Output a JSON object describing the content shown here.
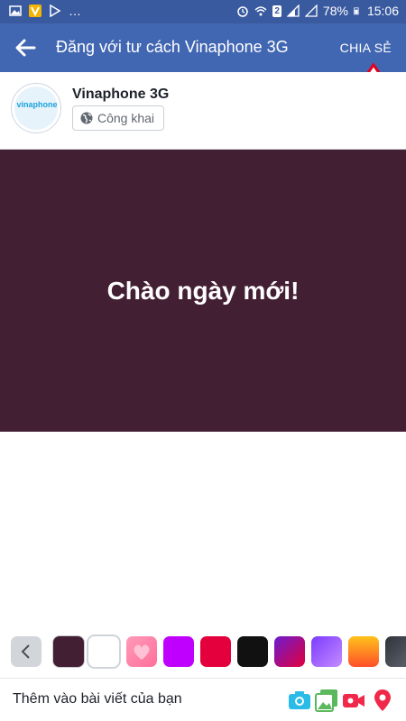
{
  "status": {
    "time": "15:06",
    "battery": "78%",
    "sim_badge": "2"
  },
  "app_bar": {
    "title": "Đăng với tư cách Vinaphone 3G",
    "share_label": "CHIA SẺ"
  },
  "author": {
    "name": "Vinaphone 3G",
    "privacy": "Công khai",
    "avatar_brand": "vinaphone"
  },
  "post": {
    "text": "Chào ngày mới!",
    "background_color": "#431f33"
  },
  "background_picker": {
    "swatches": [
      {
        "name": "dark-maroon",
        "color": "#431f33"
      },
      {
        "name": "white",
        "color": "#ffffff"
      },
      {
        "name": "pink-hearts",
        "color": "#ff8fb0"
      },
      {
        "name": "purple",
        "color": "#c000ff"
      },
      {
        "name": "crimson",
        "color": "#e3003c"
      },
      {
        "name": "black",
        "color": "#111111"
      },
      {
        "name": "purple-red-gradient",
        "color": "#8a2be2"
      },
      {
        "name": "violet-gradient",
        "color": "#9a4dff"
      },
      {
        "name": "orange-gradient",
        "color": "#ff8a2b"
      },
      {
        "name": "dark-gradient",
        "color": "#3b3f47"
      }
    ]
  },
  "bottom_bar": {
    "add_label": "Thêm vào bài viết của bạn"
  },
  "colors": {
    "app_bar": "#4267b2",
    "status_bar": "#3a5aa0",
    "annotation_arrow": "#e3001b"
  }
}
